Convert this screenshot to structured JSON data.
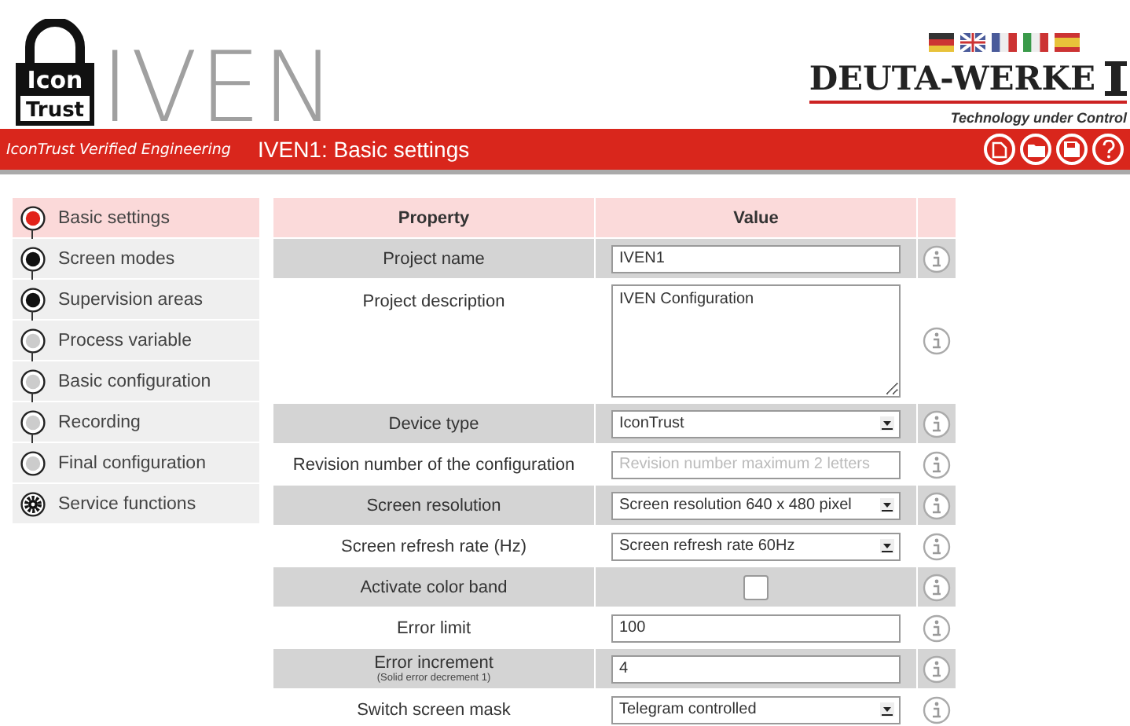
{
  "logo": {
    "lock_top": "Icon",
    "lock_bottom": "Trust",
    "name": "IVEN",
    "tagline": "IconTrust Verified Engineering"
  },
  "brand": {
    "name": "DEUTA-WERKE",
    "slogan": "Technology under Control"
  },
  "page_title": "IVEN1: Basic settings",
  "sidebar": {
    "items": [
      {
        "label": "Basic settings",
        "kind": "current",
        "selected": true
      },
      {
        "label": "Screen modes",
        "kind": "done",
        "selected": false
      },
      {
        "label": "Supervision areas",
        "kind": "done",
        "selected": false
      },
      {
        "label": "Process variable",
        "kind": "pending",
        "selected": false
      },
      {
        "label": "Basic configuration",
        "kind": "pending",
        "selected": false
      },
      {
        "label": "Recording",
        "kind": "pending",
        "selected": false
      },
      {
        "label": "Final configuration",
        "kind": "pending",
        "selected": false
      },
      {
        "label": "Service functions",
        "kind": "service",
        "selected": false
      }
    ]
  },
  "table": {
    "columns": [
      "Property",
      "Value"
    ],
    "rows": [
      {
        "label": "Project name",
        "kind": "text",
        "value": "IVEN1"
      },
      {
        "label": "Project description",
        "kind": "textarea",
        "value": "IVEN Configuration"
      },
      {
        "label": "Device type",
        "kind": "select",
        "value": "IconTrust"
      },
      {
        "label": "Revision number of the configuration",
        "kind": "text",
        "placeholder": "Revision number maximum 2 letters"
      },
      {
        "label": "Screen resolution",
        "kind": "select",
        "value": "Screen resolution 640 x 480 pixel"
      },
      {
        "label": "Screen refresh rate (Hz)",
        "kind": "select",
        "value": "Screen refresh rate 60Hz"
      },
      {
        "label": "Activate color band",
        "kind": "checkbox",
        "checked": false
      },
      {
        "label": "Error limit",
        "kind": "text",
        "value": "100"
      },
      {
        "label": "Error increment",
        "note": "(Solid error decrement 1)",
        "kind": "text",
        "value": "4"
      },
      {
        "label": "Switch screen mask",
        "kind": "select",
        "value": "Telegram controlled"
      }
    ]
  }
}
